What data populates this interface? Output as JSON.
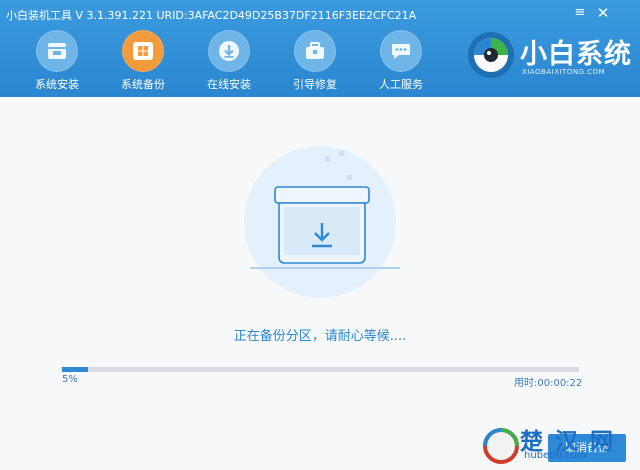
{
  "window": {
    "title": "小白装机工具 V 3.1.391.221 URID:3AFAC2D49D25B37DF2116F3EE2CFC21A",
    "menu_glyph": "≡",
    "close_glyph": "✕"
  },
  "nav": [
    {
      "label": "系统安装",
      "icon": "system-install-icon",
      "active": false
    },
    {
      "label": "系统备份",
      "icon": "windows-backup-icon",
      "active": true
    },
    {
      "label": "在线安装",
      "icon": "download-circle-icon",
      "active": false
    },
    {
      "label": "引导修复",
      "icon": "toolbox-icon",
      "active": false
    },
    {
      "label": "人工服务",
      "icon": "chat-icon",
      "active": false
    }
  ],
  "logo": {
    "title": "小白系统",
    "subtitle": "XIAOBAIXITONG.COM"
  },
  "main": {
    "status": "正在备份分区，请耐心等候....",
    "progress_fraction": 0.05,
    "progress_label": "5%",
    "elapsed": "用时:00:00:22",
    "cancel_label": "取消备份"
  },
  "watermark": {
    "text": "楚 汉 网",
    "sub": "hubeb0.com"
  },
  "colors": {
    "header": "#2a86cf",
    "accent": "#2e8ad6",
    "active_nav": "#f29b3b"
  }
}
